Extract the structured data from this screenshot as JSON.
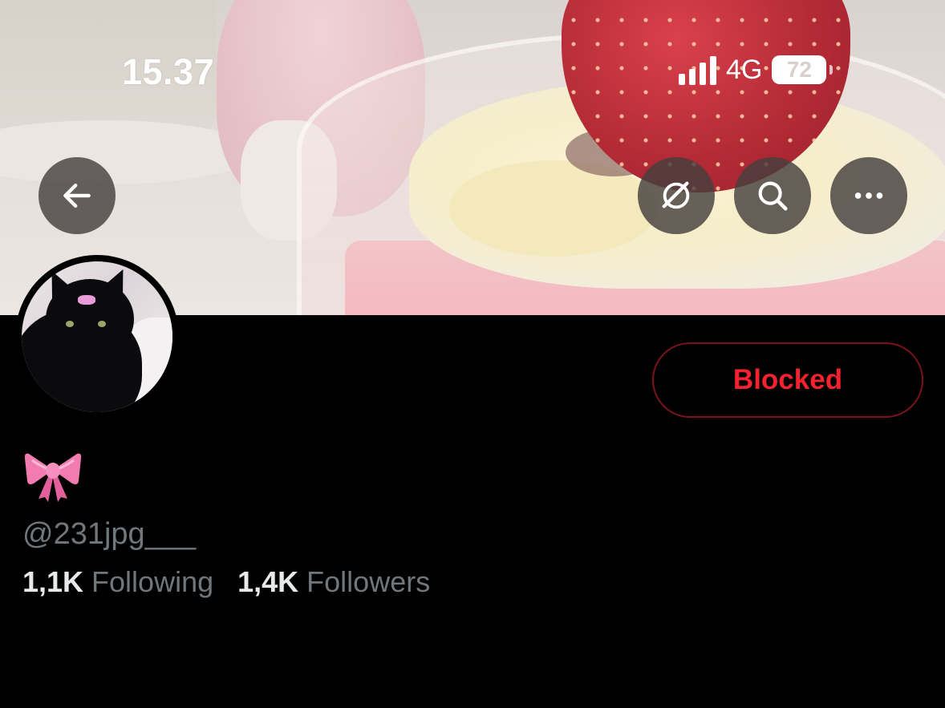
{
  "status_bar": {
    "time": "15.37",
    "network": "4G",
    "battery": "72"
  },
  "nav": {
    "back_icon": "arrow-left-icon",
    "grok_icon": "grok-icon",
    "search_icon": "search-icon",
    "more_icon": "more-horizontal-icon"
  },
  "profile": {
    "display_name_emoji": "ribbon-emoji",
    "handle": "@231jpg___",
    "following_count": "1,1K",
    "following_label": "Following",
    "followers_count": "1,4K",
    "followers_label": "Followers",
    "blocked_label": "Blocked"
  },
  "colors": {
    "blocked": "#f4212e",
    "muted_text": "#71767b",
    "primary_text": "#e7e9ea",
    "background": "#000000"
  }
}
